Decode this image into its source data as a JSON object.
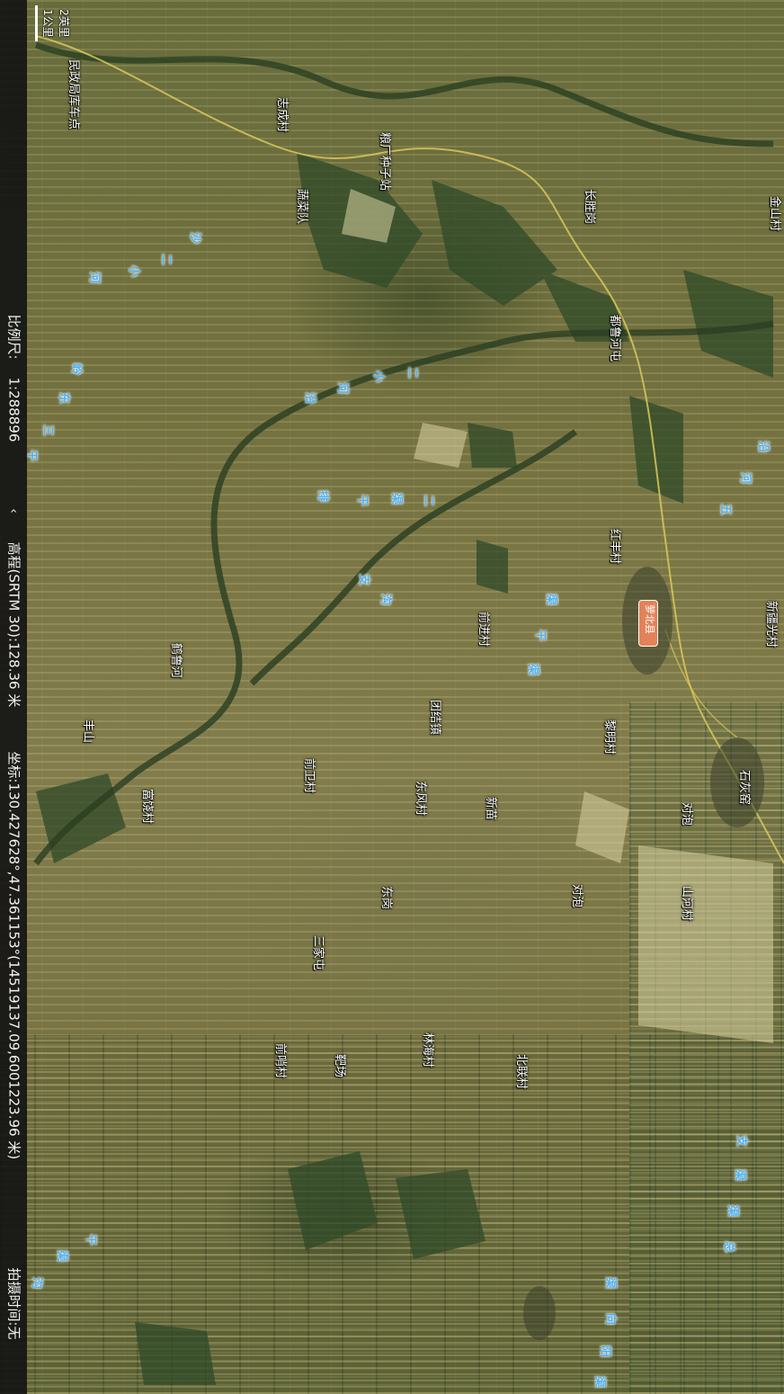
{
  "status_bar": {
    "scale_label": "比例尺:",
    "scale_value": "1:288896",
    "elevation": "高程(SRTM 30):128.36 米",
    "coords": "坐标:130.427628°,47.361153°(14519137.09,6001223.96 米)",
    "capture_time": "拍摄时间:无"
  },
  "scale_bar": {
    "km": "1公里",
    "mi": "2英里"
  },
  "colors": {
    "water_label": "#4fb0ee",
    "town_badge": "#e2825a",
    "road": "#d8c85a"
  },
  "places": [
    {
      "name": "民政局库车点"
    },
    {
      "name": "志成村"
    },
    {
      "name": "粮厂种子站"
    },
    {
      "name": "长胜岗"
    },
    {
      "name": "金山村"
    },
    {
      "name": "蔬菜队"
    },
    {
      "name": "都鲁河屯"
    },
    {
      "name": "红丰村"
    },
    {
      "name": "新疆光村"
    },
    {
      "name": "前进村"
    },
    {
      "name": "鹤鲁河"
    },
    {
      "name": "丰山"
    },
    {
      "name": "团结镇"
    },
    {
      "name": "黎明村"
    },
    {
      "name": "前卫村"
    },
    {
      "name": "东风村"
    },
    {
      "name": "新苗"
    },
    {
      "name": "石灰窑"
    },
    {
      "name": "对泡"
    },
    {
      "name": "富饶村"
    },
    {
      "name": "东岗"
    },
    {
      "name": "对泡"
    },
    {
      "name": "山河村"
    },
    {
      "name": "三家屯"
    },
    {
      "name": "林海村"
    },
    {
      "name": "前哨村"
    },
    {
      "name": "靶场"
    },
    {
      "name": "北联村"
    }
  ],
  "water": [
    {
      "name": "沙"
    },
    {
      "name": "二"
    },
    {
      "name": "小"
    },
    {
      "name": "河"
    },
    {
      "name": "岭"
    },
    {
      "name": "东"
    },
    {
      "name": "三"
    },
    {
      "name": "干"
    },
    {
      "name": "二"
    },
    {
      "name": "小"
    },
    {
      "name": "河"
    },
    {
      "name": "沿"
    },
    {
      "name": "排"
    },
    {
      "name": "干"
    },
    {
      "name": "渠"
    },
    {
      "name": "二"
    },
    {
      "name": "支"
    },
    {
      "name": "沟"
    },
    {
      "name": "渠"
    },
    {
      "name": "干"
    },
    {
      "name": "渠"
    },
    {
      "name": "沿"
    },
    {
      "name": "河"
    },
    {
      "name": "五"
    },
    {
      "name": "支"
    },
    {
      "name": "渠"
    },
    {
      "name": "渠"
    },
    {
      "name": "总"
    },
    {
      "name": "干"
    },
    {
      "name": "渠"
    },
    {
      "name": "沟"
    },
    {
      "name": "渠"
    },
    {
      "name": "向"
    },
    {
      "name": "阳"
    },
    {
      "name": "渠"
    }
  ],
  "town_badge": "萝北县"
}
